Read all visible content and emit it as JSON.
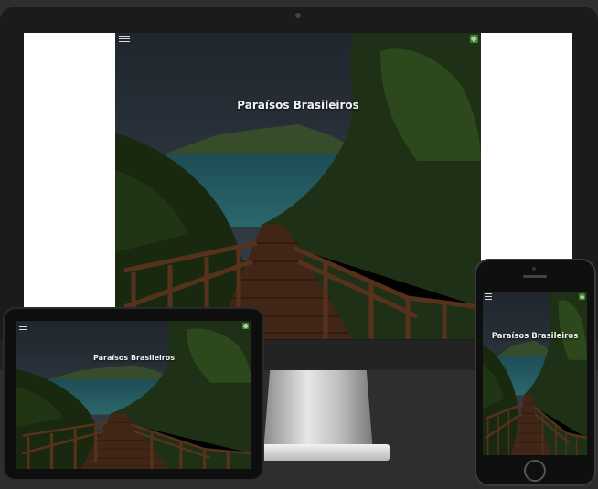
{
  "site": {
    "title": "Paraísos Brasileiros",
    "menu_icon": "hamburger-menu-icon",
    "corner_icon": "leaf-logo-icon"
  },
  "devices": [
    "desktop",
    "tablet",
    "phone"
  ],
  "colors": {
    "background": "#2e2e2e",
    "sky": "#3b4b5a",
    "sea": "#2f6f7c",
    "forest": "#2f4a1e",
    "stairs": "#6b3f25"
  }
}
